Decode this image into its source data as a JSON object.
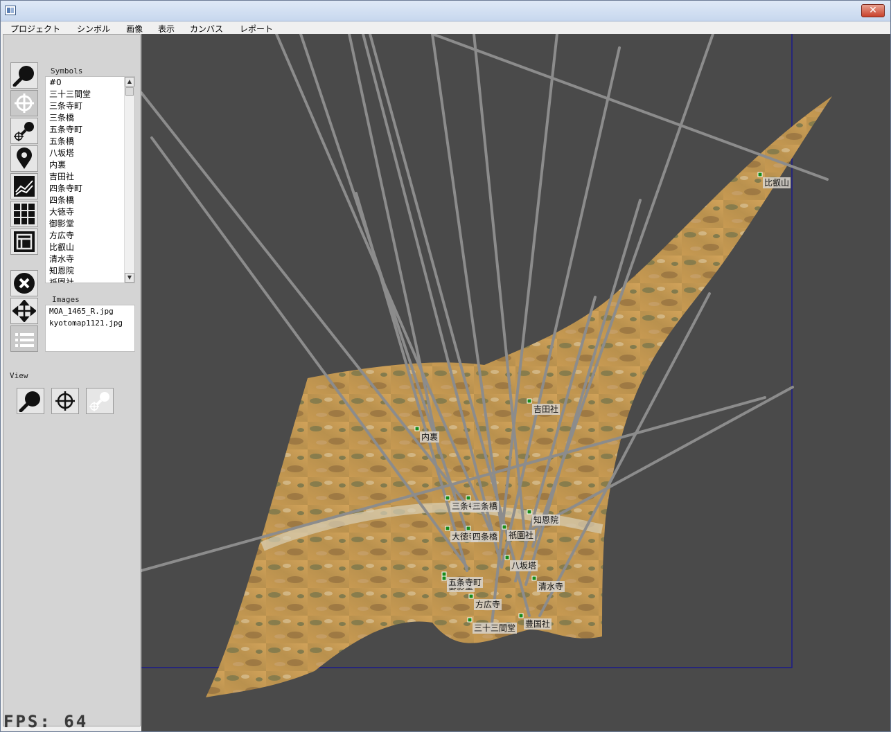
{
  "window": {
    "close_label": "✕"
  },
  "menu": [
    "プロジェクト",
    "シンボル",
    "画像",
    "表示",
    "カンバス",
    "レポート"
  ],
  "left_panel": {
    "symbols_label": "Symbols",
    "symbols": [
      "#0",
      "三十三間堂",
      "三条寺町",
      "三条橋",
      "五条寺町",
      "五条橋",
      "八坂塔",
      "内裏",
      "吉田社",
      "四条寺町",
      "四条橋",
      "大徳寺",
      "御影堂",
      "方広寺",
      "比叡山",
      "清水寺",
      "知恩院",
      "祇園社"
    ],
    "images_label": "Images",
    "images": [
      "MOA_1465_R.jpg",
      "kyotomap1121.jpg"
    ],
    "view_label": "View"
  },
  "canvas": {
    "labels": [
      {
        "text": "比叡山"
      },
      {
        "text": "吉田社"
      },
      {
        "text": "内裏"
      },
      {
        "text": "三条寺町"
      },
      {
        "text": "三条橋"
      },
      {
        "text": "知恩院"
      },
      {
        "text": "大徳寺"
      },
      {
        "text": "四条橋"
      },
      {
        "text": "祇園社"
      },
      {
        "text": "八坂塔"
      },
      {
        "text": "清水寺"
      },
      {
        "text": "御影堂"
      },
      {
        "text": "五条寺町"
      },
      {
        "text": "方広寺"
      },
      {
        "text": "豊国社"
      },
      {
        "text": "三十三間堂"
      }
    ]
  },
  "fps": "FPS: 64",
  "colors": {
    "canvas_bg": "#4a4a4a",
    "line": "#8c8c8c",
    "marker": "#1a8a1a",
    "map_base": "#c99a4e"
  }
}
